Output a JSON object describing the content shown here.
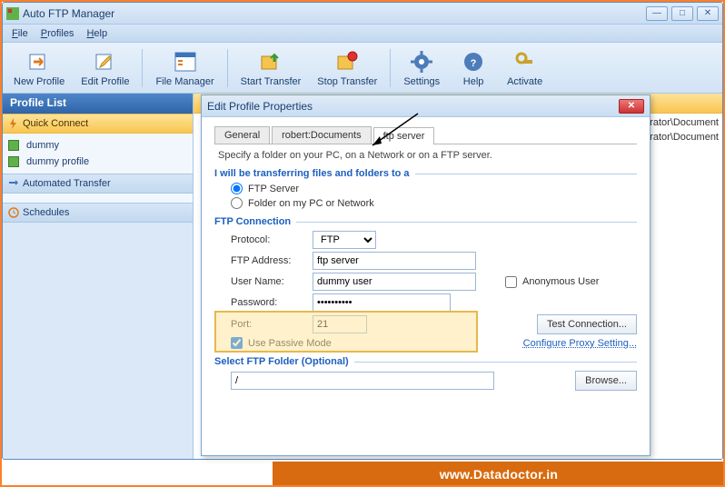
{
  "window": {
    "title": "Auto FTP Manager"
  },
  "menu": {
    "file": "File",
    "profiles": "Profiles",
    "help": "Help"
  },
  "toolbar": {
    "new_profile": "New Profile",
    "edit_profile": "Edit Profile",
    "file_manager": "File Manager",
    "start_transfer": "Start Transfer",
    "stop_transfer": "Stop Transfer",
    "settings": "Settings",
    "help": "Help",
    "activate": "Activate"
  },
  "sidebar": {
    "header": "Profile List",
    "quick_connect": "Quick Connect",
    "items": [
      "dummy",
      "dummy profile"
    ],
    "automated": "Automated Transfer",
    "schedules": "Schedules"
  },
  "main_rows": [
    "ninistrator\\Document",
    "ninistrator\\Document"
  ],
  "dialog": {
    "title": "Edit Profile Properties",
    "tabs": [
      "General",
      "robert:Documents",
      "ftp server"
    ],
    "desc": "Specify a folder on your PC, on a Network or on a  FTP server.",
    "section1": "I will be transferring files and folders to a",
    "radio1": "FTP Server",
    "radio2": "Folder on my PC or Network",
    "section2": "FTP Connection",
    "protocol_label": "Protocol:",
    "protocol_value": "FTP",
    "address_label": "FTP Address:",
    "address_value": "ftp server",
    "user_label": "User Name:",
    "user_value": "dummy user",
    "anon": "Anonymous User",
    "pass_label": "Password:",
    "pass_value": "••••••••••",
    "port_label": "Port:",
    "port_value": "21",
    "test": "Test Connection...",
    "passive": "Use Passive Mode",
    "proxy": "Configure Proxy Setting...",
    "section3": "Select FTP Folder (Optional)",
    "folder_value": "/",
    "browse": "Browse..."
  },
  "footer": "www.Datadoctor.in"
}
